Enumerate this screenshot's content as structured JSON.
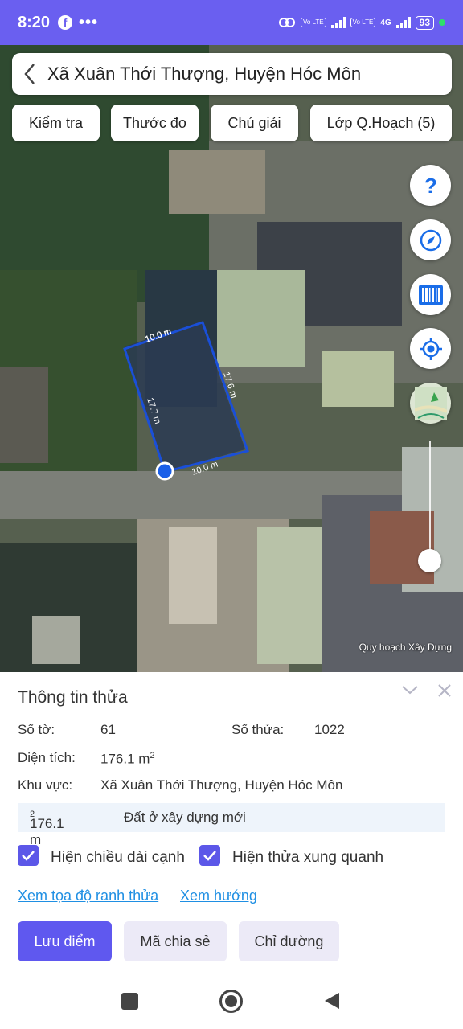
{
  "status_bar": {
    "time": "8:20",
    "facebook_icon": "f",
    "overflow": "•••",
    "battery": "93",
    "network": "4G",
    "volte1": "Vo LTE",
    "volte2": "Vo LTE"
  },
  "header": {
    "title": "Xã Xuân Thới Thượng, Huyện Hóc Môn"
  },
  "toolbar": {
    "check": "Kiểm tra",
    "measure": "Thước đo",
    "legend": "Chú giải",
    "layers": "Lớp Q.Hoạch (5)"
  },
  "map": {
    "edge_labels": [
      "10.0 m",
      "17.6 m",
      "17.7 m",
      "10.0 m"
    ],
    "watermark": "Quy hoạch Xây Dựng",
    "side_buttons": [
      "help-icon",
      "compass-icon",
      "barcode-icon",
      "my-location-icon",
      "map-layer-icon"
    ],
    "accent": "#1a4fd8"
  },
  "panel": {
    "title": "Thông tin thửa",
    "sheet_label": "Số tờ:",
    "sheet_value": "61",
    "plot_label": "Số thửa:",
    "plot_value": "1022",
    "area_label": "Diện tích:",
    "area_value": "176.1 m",
    "region_label": "Khu vực:",
    "region_value": "Xã Xuân Thới Thượng, Huyện Hóc Môn",
    "land_area": "176.1 m",
    "land_type": "Đất ở xây dựng mới",
    "show_edges": "Hiện chiều dài cạnh",
    "show_neighbors": "Hiện thửa xung quanh",
    "show_edges_checked": true,
    "show_neighbors_checked": true,
    "link_coords": "Xem tọa độ ranh thửa",
    "link_direction": "Xem hướng",
    "btn_save": "Lưu điểm",
    "btn_share": "Mã chia sẻ",
    "btn_route": "Chỉ đường",
    "superscript": "2"
  },
  "colors": {
    "primary": "#5f58ef",
    "statusbar": "#6a5ff0",
    "link": "#1f8fe3"
  }
}
